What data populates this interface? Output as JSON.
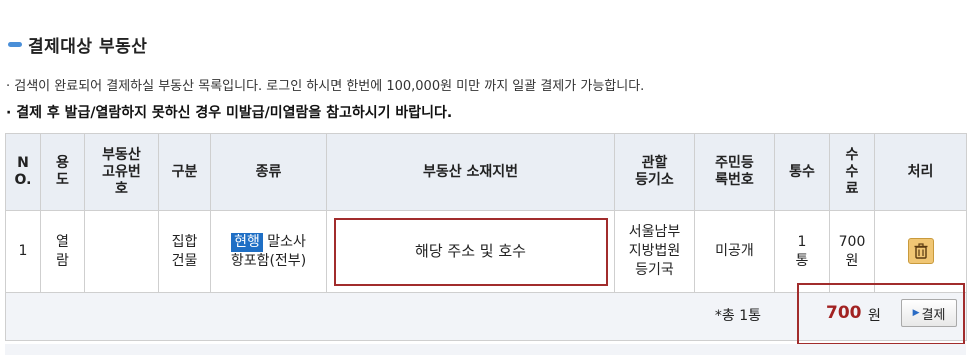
{
  "section": {
    "title": "결제대상 부동산"
  },
  "notes": [
    "· 검색이 완료되어 결제하실 부동산 목록입니다. 로그인 하시면 한번에 100,000원 미만 까지 일괄 결제가 가능합니다.",
    "· 결제 후 발급/열람하지 못하신 경우 미발급/미열람을 참고하시기 바랍니다."
  ],
  "table": {
    "headers": {
      "no": [
        "N",
        "O."
      ],
      "purpose": [
        "용",
        "도"
      ],
      "unique_no": [
        "부동산",
        "고유번",
        "호"
      ],
      "category": [
        "구분"
      ],
      "kind": [
        "종류"
      ],
      "address": [
        "부동산 소재지번"
      ],
      "registry": [
        "관할",
        "등기소"
      ],
      "resident_no": [
        "주민등",
        "록번호"
      ],
      "copies": [
        "통수"
      ],
      "fee": [
        "수",
        "수",
        "료"
      ],
      "action": [
        "처리"
      ]
    },
    "row": {
      "no": "1",
      "purpose": [
        "열",
        "람"
      ],
      "unique_no": "",
      "category": [
        "집합",
        "건물"
      ],
      "kind_badge": "현행",
      "kind_text_1": "말소사",
      "kind_text_2": "항포함(전부)",
      "address": "해당 주소 및 호수",
      "registry": [
        "서울남부",
        "지방법원",
        "등기국"
      ],
      "resident_no": "미공개",
      "copies_num": "1",
      "copies_unit": "통",
      "fee": [
        "700",
        "원"
      ],
      "action_icon": "trash-icon"
    },
    "summary": {
      "total_label": "*총 1통",
      "amount": "700",
      "amount_unit": "원",
      "pay_button": "결제"
    }
  },
  "colors": {
    "accent_blue": "#1f6fc5",
    "highlight_red": "#a12c2c",
    "amount_red": "#a22222"
  }
}
